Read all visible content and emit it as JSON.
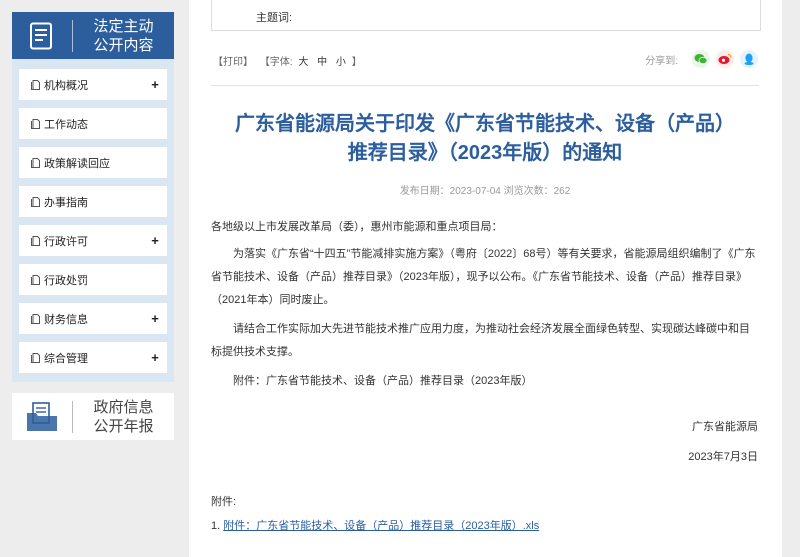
{
  "sidebar": {
    "banner": {
      "line1": "法定主动",
      "line2": "公开内容",
      "icon": "document-list-icon",
      "bg": "#2c5e9e"
    },
    "items": [
      {
        "label": "机构概况",
        "expand": "+"
      },
      {
        "label": "工作动态",
        "expand": ""
      },
      {
        "label": "政策解读回应",
        "expand": ""
      },
      {
        "label": "办事指南",
        "expand": ""
      },
      {
        "label": "行政许可",
        "expand": "+"
      },
      {
        "label": "行政处罚",
        "expand": ""
      },
      {
        "label": "财务信息",
        "expand": "+"
      },
      {
        "label": "综合管理",
        "expand": "+"
      }
    ],
    "annual": {
      "line1": "政府信息",
      "line2": "公开年报",
      "icon": "report-folder-icon"
    }
  },
  "article": {
    "subject_label": "主题词:",
    "tools": {
      "print": "【打印】",
      "font": "【字体:",
      "large": "大",
      "medium": "中",
      "small": "小",
      "close": "】"
    },
    "share": {
      "label": "分享到:",
      "icons": [
        "wechat-icon",
        "weibo-icon",
        "qq-icon"
      ]
    },
    "title_line1": "广东省能源局关于印发《广东省节能技术、设备（产品）",
    "title_line2": "推荐目录》（2023年版）的通知",
    "meta": "发布日期：2023-07-04  浏览次数：262",
    "salutation": "各地级以上市发展改革局（委），惠州市能源和重点项目局：",
    "para1": "为落实《广东省“十四五”节能减排实施方案》（粤府〔2022〕68号）等有关要求，省能源局组织编制了《广东省节能技术、设备（产品）推荐目录》（2023年版），现予以公布。《广东省节能技术、设备（产品）推荐目录》（2021年本）同时废止。",
    "para2": "请结合工作实际加大先进节能技术推广应用力度，为推动社会经济发展全面绿色转型、实现碳达峰碳中和目标提供技术支撑。",
    "attachment_line": "附件：广东省节能技术、设备（产品）推荐目录（2023年版）",
    "signer": "广东省能源局",
    "date": "2023年7月3日",
    "attachments_label": "附件:",
    "attachment_index": "1.",
    "attachment_link": "附件：广东省节能技术、设备（产品）推荐目录（2023年版）.xls"
  },
  "colors": {
    "accent": "#2c5e9e",
    "wechat": "#3fb338",
    "weibo": "#e6162d",
    "qq": "#1da1f2"
  }
}
